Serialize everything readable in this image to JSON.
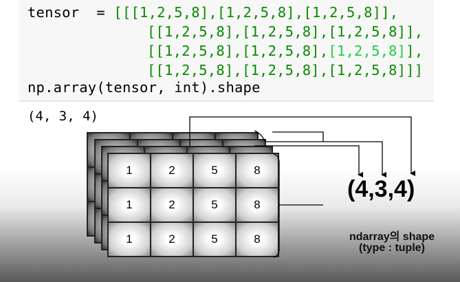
{
  "code": {
    "line1_lead": "tensor  = ",
    "line1_data": "[[[1,2,5,8],[1,2,5,8],[1,2,5,8]],",
    "line2_data": "[[1,2,5,8],[1,2,5,8],[1,2,5,8]],",
    "line3_a": "[[1,2,5,8],[1,2,5,8],",
    "line3_b": "[1,2,5,8]",
    "line3_c": "],",
    "line4_data": "[[1,2,5,8],[1,2,5,8],[1,2,5,8]]]",
    "line5": "np.array(tensor, int).shape"
  },
  "output": "(4, 3, 4)",
  "tensor_grid": {
    "rows": [
      [
        "1",
        "2",
        "5",
        "8"
      ],
      [
        "1",
        "2",
        "5",
        "8"
      ],
      [
        "1",
        "2",
        "5",
        "8"
      ]
    ]
  },
  "annotation": {
    "shape": "(4,3,4)",
    "caption_line1": "ndarray의 shape",
    "caption_line2": "(type : tuple)"
  }
}
